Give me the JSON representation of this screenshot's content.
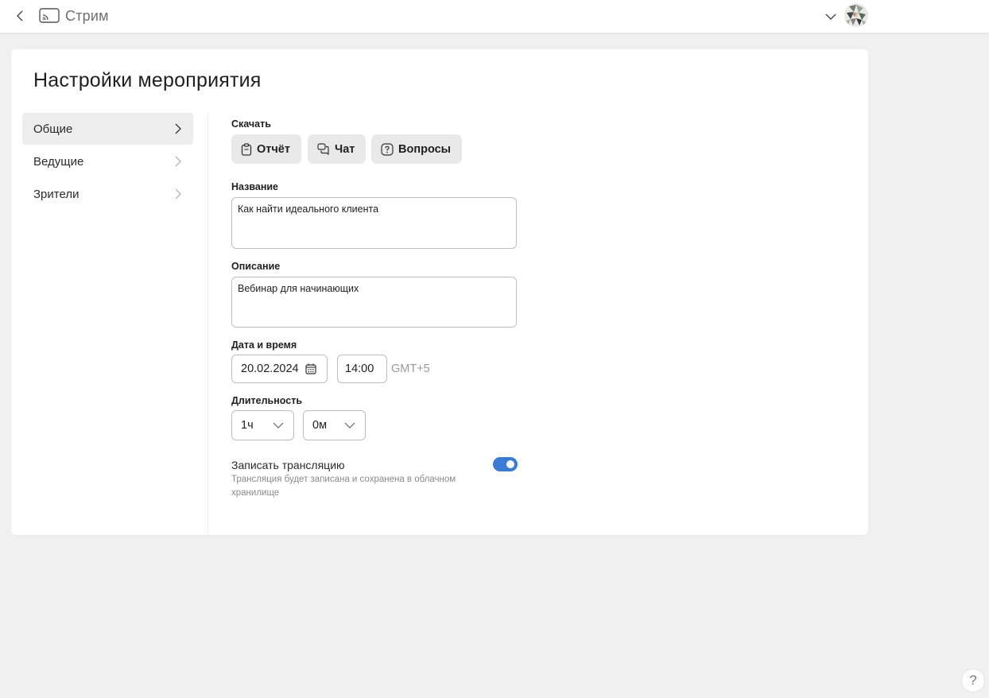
{
  "app": {
    "title": "Стрим"
  },
  "page": {
    "title": "Настройки мероприятия"
  },
  "nav": {
    "items": [
      {
        "label": "Общие",
        "active": true
      },
      {
        "label": "Ведущие",
        "active": false
      },
      {
        "label": "Зрители",
        "active": false
      }
    ]
  },
  "download": {
    "label": "Скачать",
    "buttons": [
      {
        "label": "Отчёт",
        "icon": "clipboard-icon"
      },
      {
        "label": "Чат",
        "icon": "chat-icon"
      },
      {
        "label": "Вопросы",
        "icon": "question-icon"
      }
    ]
  },
  "name": {
    "label": "Название",
    "value": "Как найти идеального клиента"
  },
  "description": {
    "label": "Описание",
    "value": "Вебинар для начинающих"
  },
  "datetime": {
    "label": "Дата и время",
    "date": "20.02.2024",
    "time": "14:00",
    "timezone": "GMT+5"
  },
  "duration": {
    "label": "Длительность",
    "hours": "1ч",
    "minutes": "0м"
  },
  "record": {
    "title": "Записать трансляцию",
    "description": "Трансляция будет записана и сохранена в облачном хранилище",
    "enabled": true
  },
  "help": {
    "label": "?"
  },
  "colors": {
    "accent": "#3a7bd5",
    "background": "#f0f0f0",
    "button_bg": "#e9e9e9"
  }
}
